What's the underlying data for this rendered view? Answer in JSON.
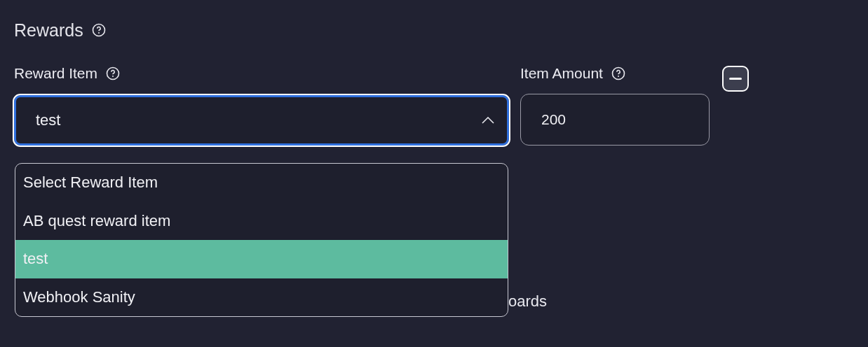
{
  "section": {
    "title": "Rewards"
  },
  "reward_item": {
    "label": "Reward Item",
    "value": "test",
    "expanded": true,
    "options": [
      {
        "label": "Select Reward Item",
        "selected": false
      },
      {
        "label": "AB quest reward item",
        "selected": false
      },
      {
        "label": "test",
        "selected": true
      },
      {
        "label": "Webhook Sanity",
        "selected": false
      }
    ]
  },
  "item_amount": {
    "label": "Item Amount",
    "value": "200"
  },
  "hidden_label": "oards"
}
